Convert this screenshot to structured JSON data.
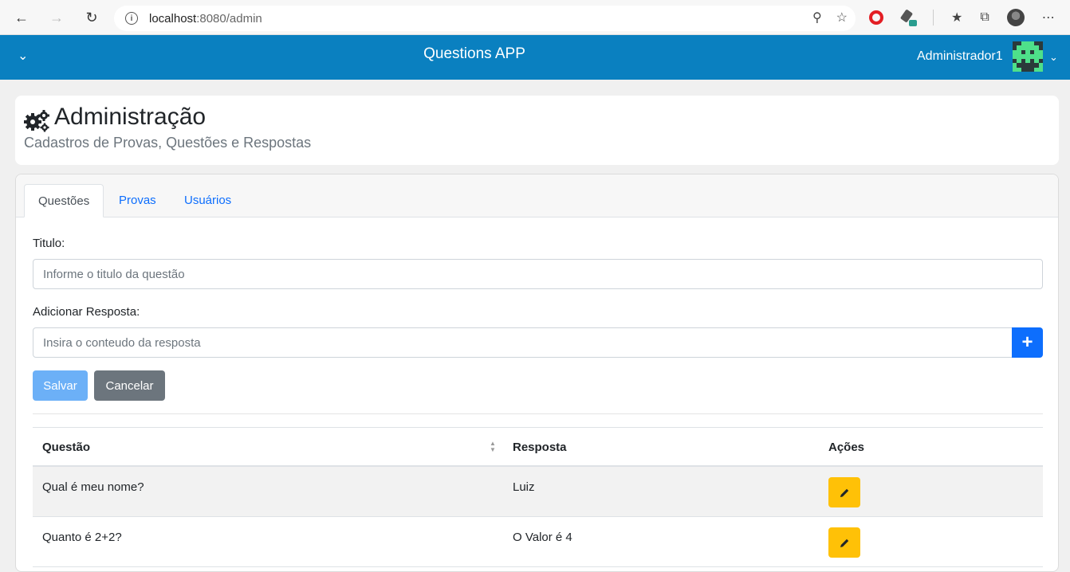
{
  "browser": {
    "url_host": "localhost",
    "url_path": ":8080/admin"
  },
  "header": {
    "app_title": "Questions APP",
    "user_name": "Administrador1"
  },
  "page": {
    "title": "Administração",
    "subtitle": "Cadastros de Provas, Questões e Respostas"
  },
  "tabs": [
    {
      "label": "Questões",
      "active": true
    },
    {
      "label": "Provas",
      "active": false
    },
    {
      "label": "Usuários",
      "active": false
    }
  ],
  "form": {
    "title_label": "Titulo:",
    "title_placeholder": "Informe o titulo da questão",
    "answer_label": "Adicionar Resposta:",
    "answer_placeholder": "Insira o conteudo da resposta",
    "add_button": "+",
    "save_button": "Salvar",
    "cancel_button": "Cancelar"
  },
  "table": {
    "columns": [
      "Questão",
      "Resposta",
      "Ações"
    ],
    "rows": [
      {
        "question": "Qual é meu nome?",
        "answer": "Luiz"
      },
      {
        "question": "Quanto é 2+2?",
        "answer": "O Valor é 4"
      }
    ]
  },
  "colors": {
    "header_bg": "#0a80c0",
    "primary": "#0d6efd",
    "warning": "#ffc107",
    "secondary": "#6c757d"
  }
}
